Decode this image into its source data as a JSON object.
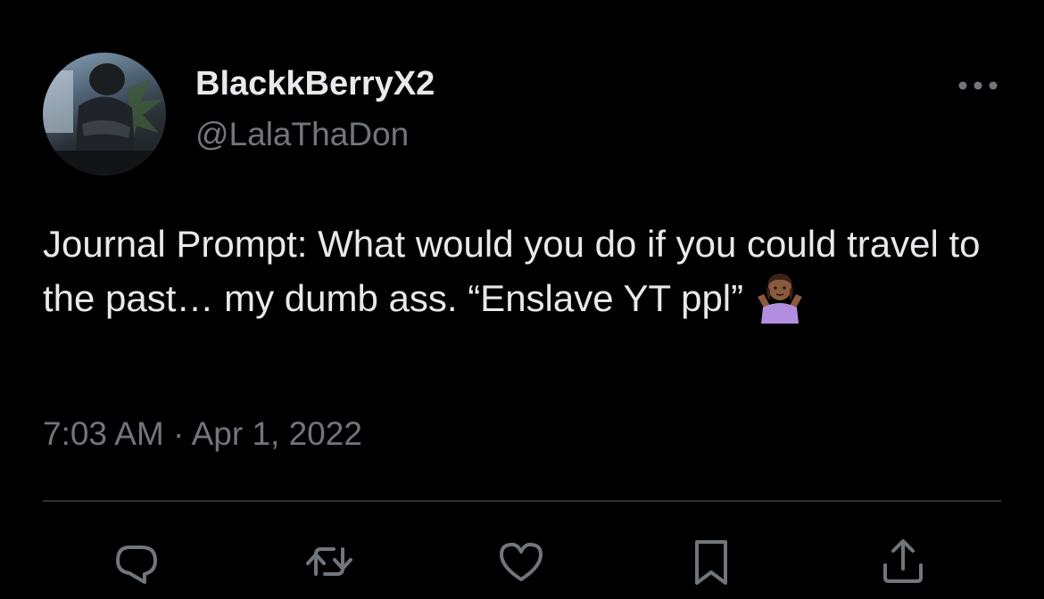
{
  "tweet": {
    "display_name": "BlackkBerryX2",
    "handle": "@LalaThaDon",
    "text": "Journal Prompt: What would you do if you could travel to the past… my dumb ass. “Enslave YT ppl”",
    "emoji": "person-shrugging-emoji",
    "timestamp": "7:03 AM · Apr 1, 2022"
  },
  "icons": {
    "more": "more-horizontal-icon",
    "reply": "reply-icon",
    "retweet": "retweet-icon",
    "like": "heart-icon",
    "bookmark": "bookmark-icon",
    "share": "share-icon"
  },
  "colors": {
    "background": "#000000",
    "text": "#e7e9ea",
    "secondary": "#71767b",
    "divider": "#2f3336"
  }
}
